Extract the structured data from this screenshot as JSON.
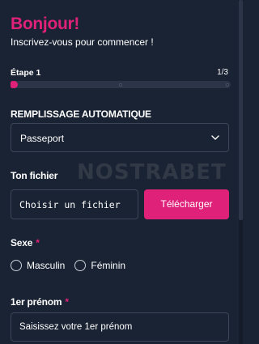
{
  "header": {
    "title": "Bonjour!",
    "subtitle": "Inscrivez-vous pour commencer !"
  },
  "steps": {
    "label": "Étape 1",
    "count": "1/3",
    "current": 1,
    "total": 3,
    "progress_fraction": 0.02
  },
  "autofill": {
    "label": "REMPLISSAGE AUTOMATIQUE",
    "selected": "Passeport"
  },
  "file": {
    "label": "Ton fichier",
    "choose_text": "Choisir un fichier",
    "upload_label": "Télécharger"
  },
  "gender": {
    "label": "Sexe",
    "required_mark": "*",
    "options": [
      "Masculin",
      "Féminin"
    ]
  },
  "first_name": {
    "label": "1er prénom",
    "required_mark": "*",
    "placeholder": "Saisissez votre 1er prénom"
  },
  "watermark": "NOSTRABET",
  "colors": {
    "accent": "#e0217a",
    "background": "#1a2333",
    "border": "#3b4658"
  },
  "icons": {
    "select": "chevron-down-icon"
  }
}
